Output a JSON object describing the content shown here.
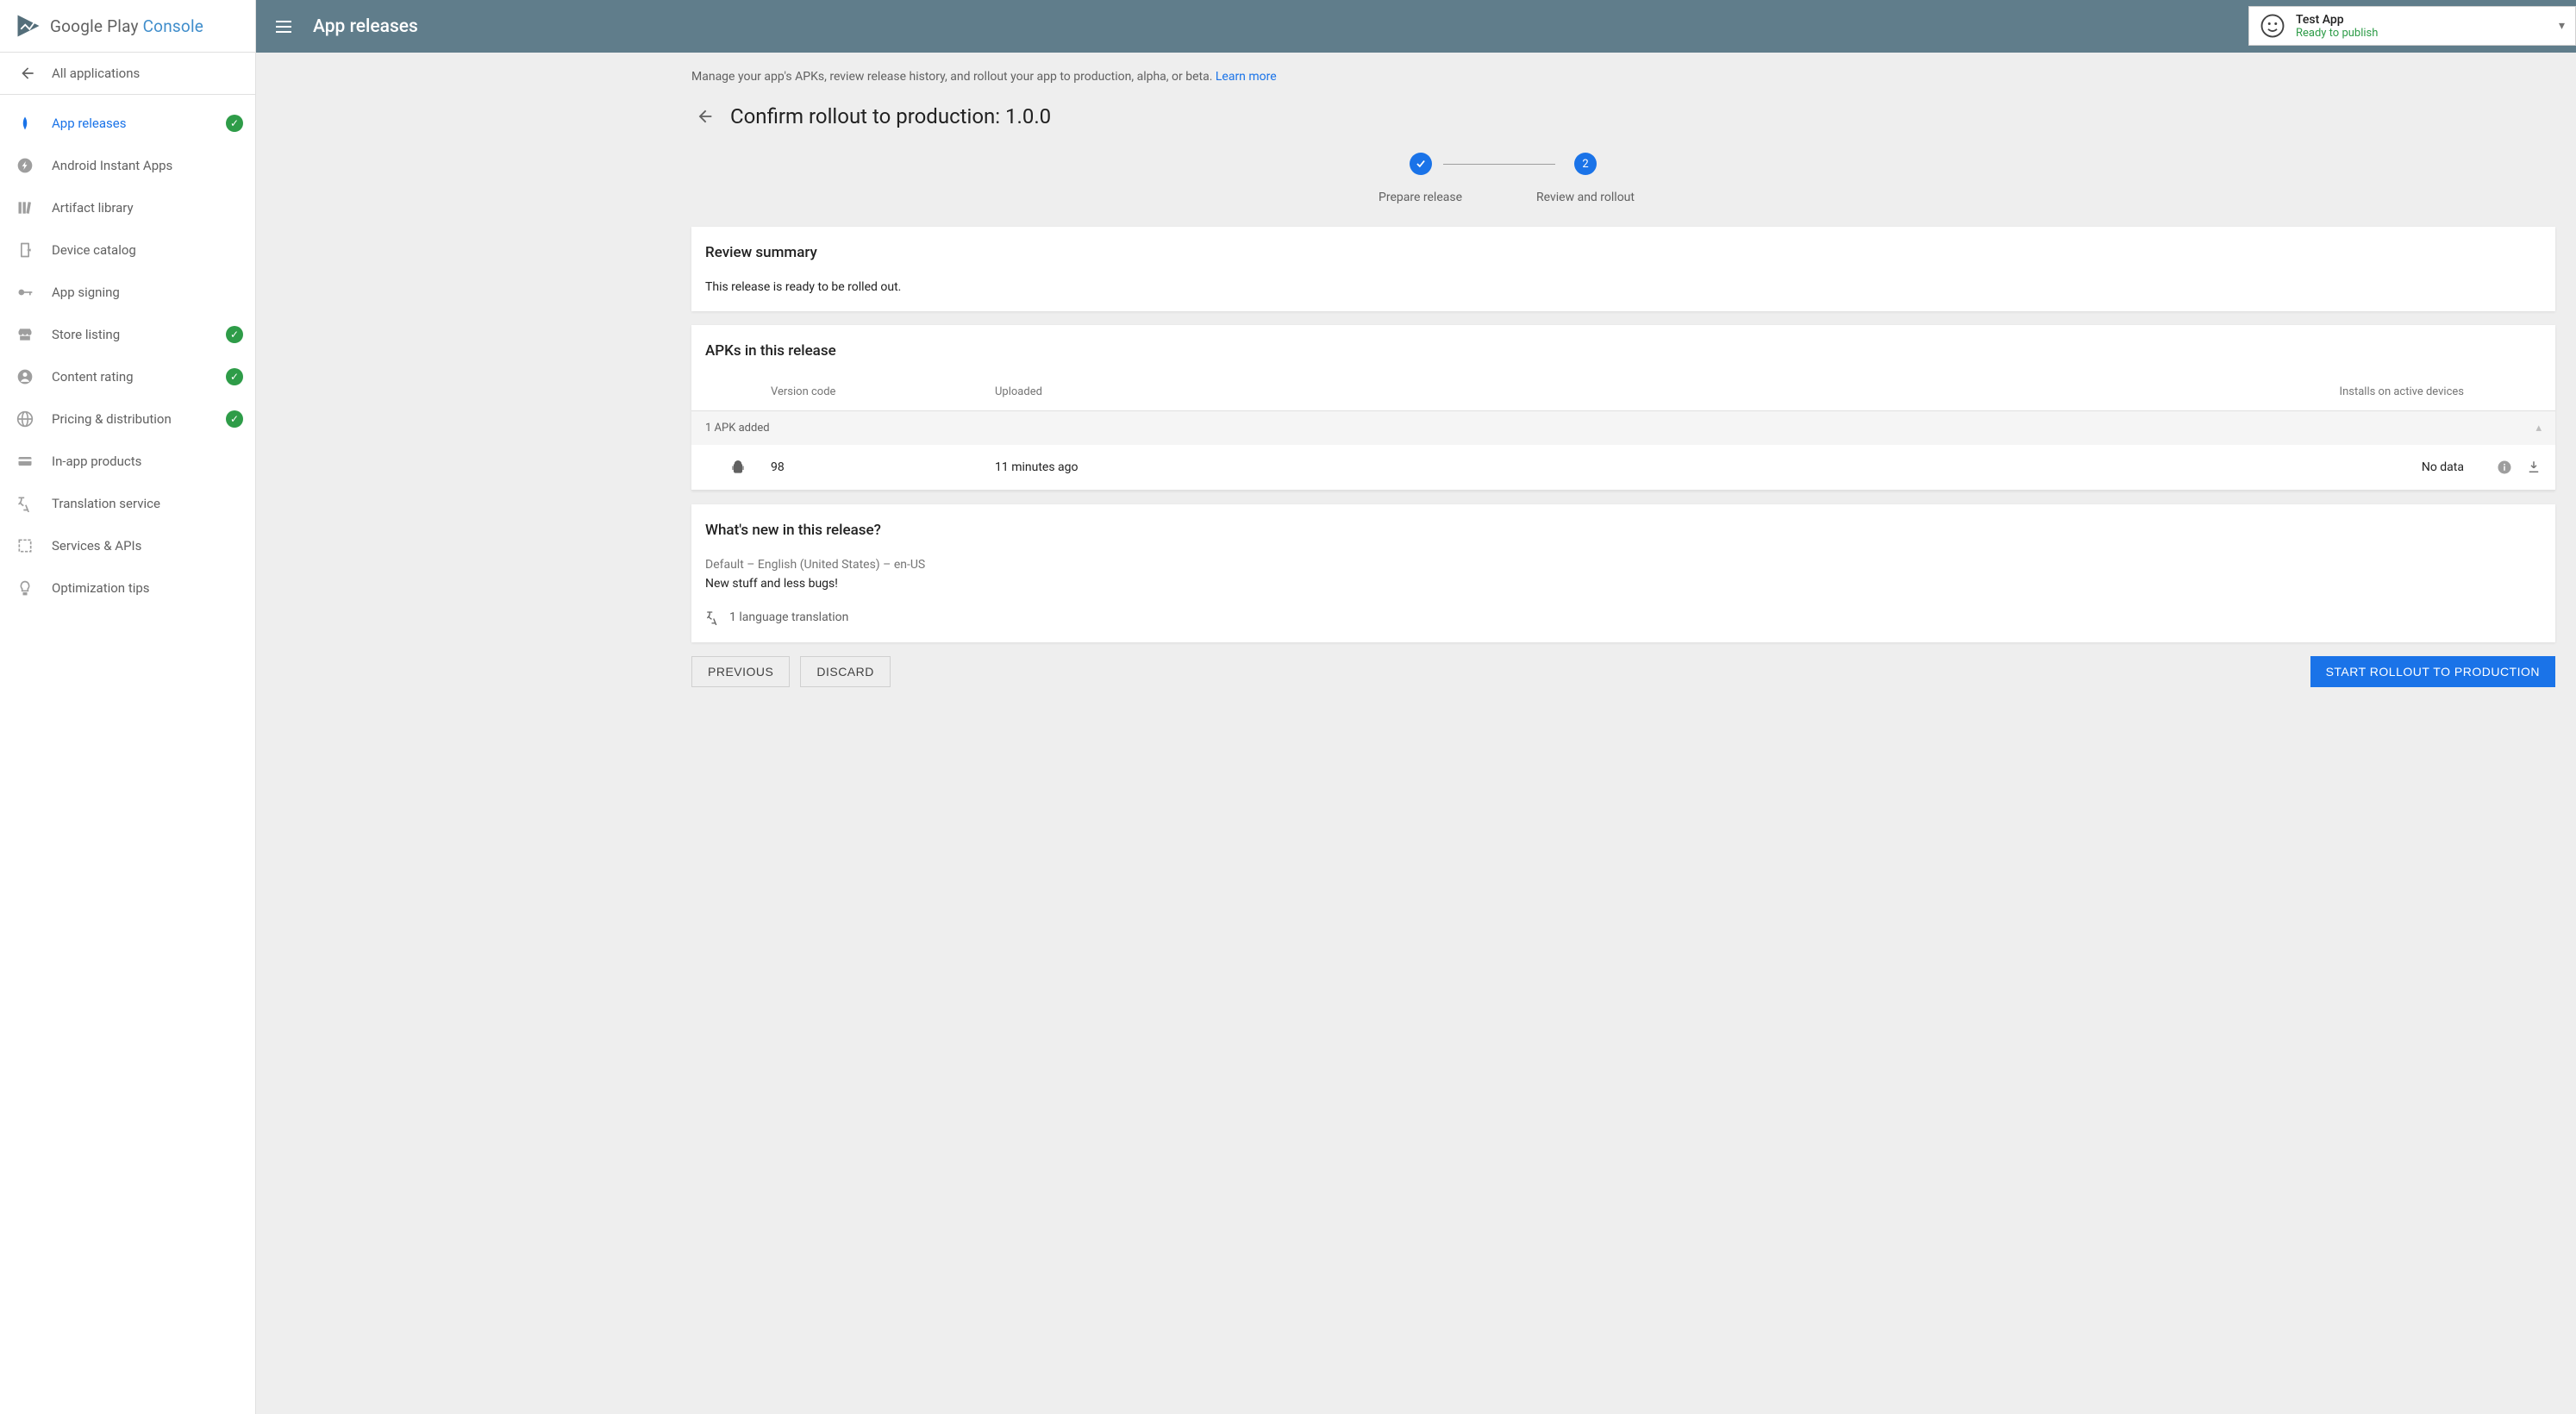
{
  "logo": {
    "word1": "Google Play ",
    "word2": "Console"
  },
  "all_applications": "All applications",
  "nav": [
    {
      "label": "App releases",
      "active": true,
      "check": true,
      "icon": "rocket"
    },
    {
      "label": "Android Instant Apps",
      "active": false,
      "check": false,
      "icon": "bolt"
    },
    {
      "label": "Artifact library",
      "active": false,
      "check": false,
      "icon": "library"
    },
    {
      "label": "Device catalog",
      "active": false,
      "check": false,
      "icon": "device"
    },
    {
      "label": "App signing",
      "active": false,
      "check": false,
      "icon": "key"
    },
    {
      "label": "Store listing",
      "active": false,
      "check": true,
      "icon": "store"
    },
    {
      "label": "Content rating",
      "active": false,
      "check": true,
      "icon": "rating"
    },
    {
      "label": "Pricing & distribution",
      "active": false,
      "check": true,
      "icon": "globe"
    },
    {
      "label": "In-app products",
      "active": false,
      "check": false,
      "icon": "card"
    },
    {
      "label": "Translation service",
      "active": false,
      "check": false,
      "icon": "translate"
    },
    {
      "label": "Services & APIs",
      "active": false,
      "check": false,
      "icon": "extension"
    },
    {
      "label": "Optimization tips",
      "active": false,
      "check": false,
      "icon": "bulb"
    }
  ],
  "header": {
    "title": "App releases"
  },
  "switcher": {
    "name": "Test App",
    "status": "Ready to publish"
  },
  "intro": {
    "text": "Manage your app's APKs, review release history, and rollout your app to production, alpha, or beta. ",
    "link": "Learn more"
  },
  "page": {
    "title": "Confirm rollout to production: 1.0.0"
  },
  "stepper": {
    "step1": "Prepare release",
    "step2_num": "2",
    "step2": "Review and rollout"
  },
  "review": {
    "title": "Review summary",
    "body": "This release is ready to be rolled out."
  },
  "apks": {
    "title": "APKs in this release",
    "columns": {
      "version": "Version code",
      "uploaded": "Uploaded",
      "installs": "Installs on active devices"
    },
    "group": "1 APK added",
    "row": {
      "version": "98",
      "uploaded": "11 minutes ago",
      "installs": "No data"
    }
  },
  "whatsnew": {
    "title": "What's new in this release?",
    "lang_line": "Default – English (United States) – en-US",
    "body": "New stuff and less bugs!",
    "translation": "1 language translation"
  },
  "buttons": {
    "previous": "PREVIOUS",
    "discard": "DISCARD",
    "start": "START ROLLOUT TO PRODUCTION"
  }
}
